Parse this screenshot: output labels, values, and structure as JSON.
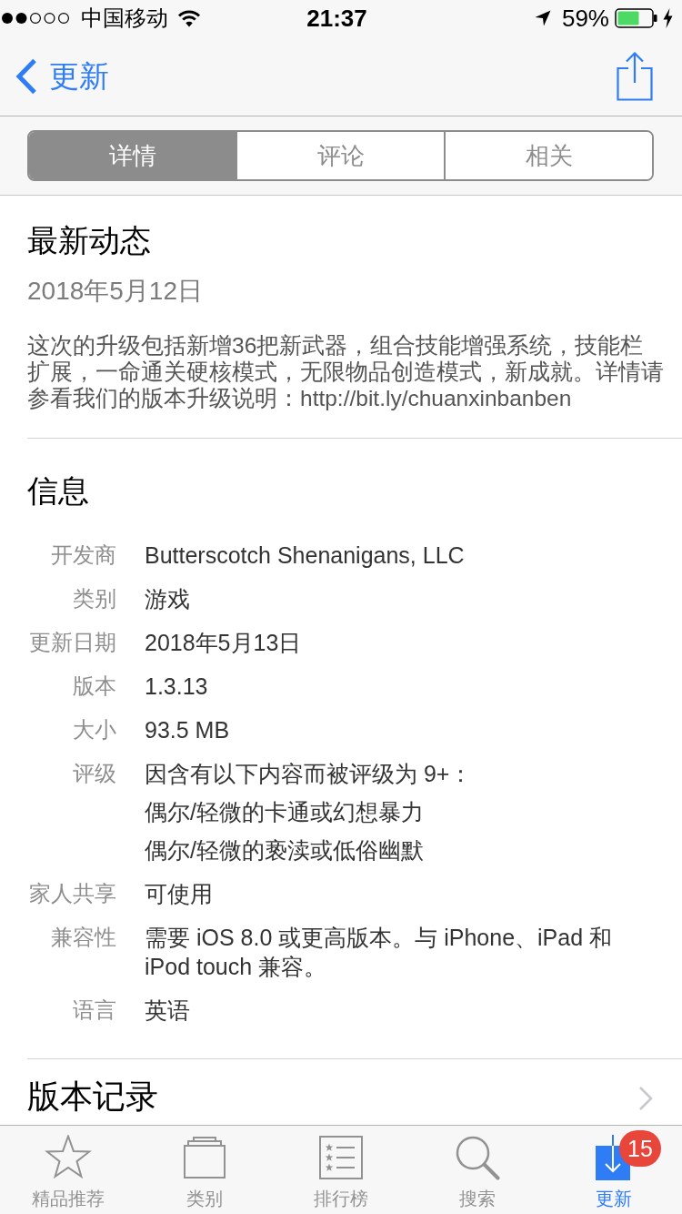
{
  "status_bar": {
    "carrier": "中国移动",
    "time": "21:37",
    "battery": "59%",
    "charging": true
  },
  "nav_bar": {
    "back_label": "更新"
  },
  "segments": [
    {
      "label": "详情",
      "selected": true
    },
    {
      "label": "评论",
      "selected": false
    },
    {
      "label": "相关",
      "selected": false
    }
  ],
  "whats_new": {
    "title": "最新动态",
    "date": "2018年5月12日",
    "notes": "这次的升级包括新增36把新武器，组合技能增强系统，技能栏扩展，一命通关硬核模式，无限物品创造模式，新成就。详情请参看我们的版本升级说明：http://bit.ly/chuanxinbanben"
  },
  "info": {
    "title": "信息",
    "rows": [
      {
        "label": "开发商",
        "lines": [
          "Butterscotch Shenanigans, LLC"
        ]
      },
      {
        "label": "类别",
        "lines": [
          "游戏"
        ]
      },
      {
        "label": "更新日期",
        "lines": [
          "2018年5月13日"
        ]
      },
      {
        "label": "版本",
        "lines": [
          "1.3.13"
        ]
      },
      {
        "label": "大小",
        "lines": [
          "93.5 MB"
        ]
      },
      {
        "label": "评级",
        "lines": [
          "因含有以下内容而被评级为 9+：",
          "偶尔/轻微的卡通或幻想暴力",
          "偶尔/轻微的亵渎或低俗幽默"
        ]
      },
      {
        "label": "家人共享",
        "lines": [
          "可使用"
        ]
      },
      {
        "label": "兼容性",
        "lines": [
          "需要 iOS 8.0 或更高版本。与 iPhone、iPad 和 iPod touch 兼容。"
        ]
      },
      {
        "label": "语言",
        "lines": [
          "英语"
        ]
      }
    ]
  },
  "version_history": {
    "title": "版本记录"
  },
  "tab_bar": [
    {
      "kind": "featured",
      "label": "精品推荐",
      "selected": false
    },
    {
      "kind": "categories",
      "label": "类别",
      "selected": false
    },
    {
      "kind": "charts",
      "label": "排行榜",
      "selected": false
    },
    {
      "kind": "search",
      "label": "搜索",
      "selected": false
    },
    {
      "kind": "updates",
      "label": "更新",
      "selected": true,
      "badge": "15"
    }
  ]
}
